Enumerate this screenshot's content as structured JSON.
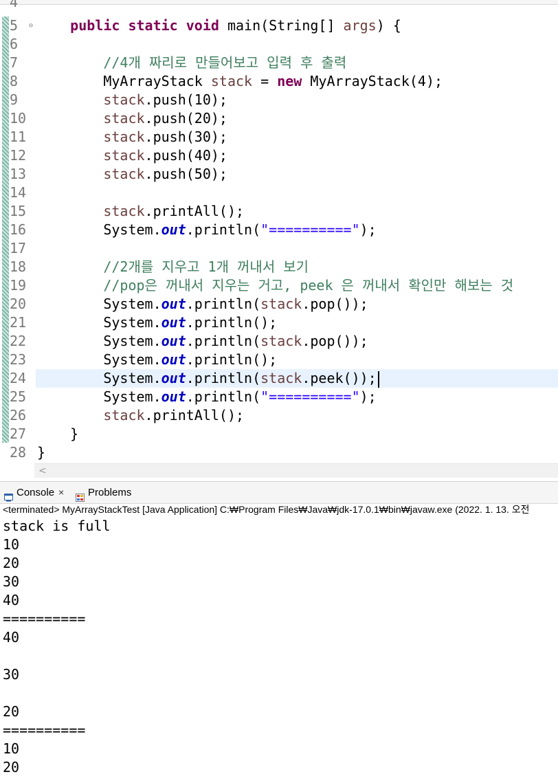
{
  "editor": {
    "top_partial_line_number": "4",
    "lines": [
      {
        "n": "5",
        "fold": "⊖",
        "tokens": [
          [
            "",
            "    "
          ],
          [
            "kw",
            "public static void "
          ],
          [
            "",
            "main(String[] "
          ],
          [
            "var",
            "args"
          ],
          [
            "",
            ") {"
          ]
        ]
      },
      {
        "n": "6",
        "tokens": []
      },
      {
        "n": "7",
        "tokens": [
          [
            "",
            "        "
          ],
          [
            "cm",
            "//4개 짜리로 만들어보고 입력 후 출력"
          ]
        ]
      },
      {
        "n": "8",
        "tokens": [
          [
            "",
            "        MyArrayStack "
          ],
          [
            "var",
            "stack"
          ],
          [
            "",
            " = "
          ],
          [
            "kw",
            "new"
          ],
          [
            "",
            " MyArrayStack(4);"
          ]
        ]
      },
      {
        "n": "9",
        "tokens": [
          [
            "",
            "        "
          ],
          [
            "var",
            "stack"
          ],
          [
            "",
            ".push(10);"
          ]
        ]
      },
      {
        "n": "10",
        "tokens": [
          [
            "",
            "        "
          ],
          [
            "var",
            "stack"
          ],
          [
            "",
            ".push(20);"
          ]
        ]
      },
      {
        "n": "11",
        "tokens": [
          [
            "",
            "        "
          ],
          [
            "var",
            "stack"
          ],
          [
            "",
            ".push(30);"
          ]
        ]
      },
      {
        "n": "12",
        "tokens": [
          [
            "",
            "        "
          ],
          [
            "var",
            "stack"
          ],
          [
            "",
            ".push(40);"
          ]
        ]
      },
      {
        "n": "13",
        "tokens": [
          [
            "",
            "        "
          ],
          [
            "var",
            "stack"
          ],
          [
            "",
            ".push(50);"
          ]
        ]
      },
      {
        "n": "14",
        "tokens": []
      },
      {
        "n": "15",
        "tokens": [
          [
            "",
            "        "
          ],
          [
            "var",
            "stack"
          ],
          [
            "",
            ".printAll();"
          ]
        ]
      },
      {
        "n": "16",
        "tokens": [
          [
            "",
            "        System."
          ],
          [
            "fld",
            "out"
          ],
          [
            "",
            ".println("
          ],
          [
            "str",
            "\"==========\""
          ],
          [
            "",
            ");"
          ]
        ]
      },
      {
        "n": "17",
        "tokens": []
      },
      {
        "n": "18",
        "tokens": [
          [
            "",
            "        "
          ],
          [
            "cm",
            "//2개를 지우고 1개 꺼내서 보기"
          ]
        ]
      },
      {
        "n": "19",
        "tokens": [
          [
            "",
            "        "
          ],
          [
            "cm",
            "//pop은 꺼내서 지우는 거고, peek 은 꺼내서 확인만 해보는 것"
          ]
        ]
      },
      {
        "n": "20",
        "tokens": [
          [
            "",
            "        System."
          ],
          [
            "fld",
            "out"
          ],
          [
            "",
            ".println("
          ],
          [
            "var",
            "stack"
          ],
          [
            "",
            ".pop());"
          ]
        ]
      },
      {
        "n": "21",
        "tokens": [
          [
            "",
            "        System."
          ],
          [
            "fld",
            "out"
          ],
          [
            "",
            ".println();"
          ]
        ]
      },
      {
        "n": "22",
        "tokens": [
          [
            "",
            "        System."
          ],
          [
            "fld",
            "out"
          ],
          [
            "",
            ".println("
          ],
          [
            "var",
            "stack"
          ],
          [
            "",
            ".pop());"
          ]
        ]
      },
      {
        "n": "23",
        "tokens": [
          [
            "",
            "        System."
          ],
          [
            "fld",
            "out"
          ],
          [
            "",
            ".println();"
          ]
        ]
      },
      {
        "n": "24",
        "current": true,
        "tokens": [
          [
            "",
            "        System."
          ],
          [
            "fld",
            "out"
          ],
          [
            "",
            ".println("
          ],
          [
            "var",
            "stack"
          ],
          [
            "",
            ".peek());"
          ]
        ]
      },
      {
        "n": "25",
        "tokens": [
          [
            "",
            "        System."
          ],
          [
            "fld",
            "out"
          ],
          [
            "",
            ".println("
          ],
          [
            "str",
            "\"==========\""
          ],
          [
            "",
            ");"
          ]
        ]
      },
      {
        "n": "26",
        "tokens": [
          [
            "",
            "        "
          ],
          [
            "var",
            "stack"
          ],
          [
            "",
            ".printAll();"
          ]
        ]
      },
      {
        "n": "27",
        "tokens": [
          [
            "",
            "    }"
          ]
        ]
      },
      {
        "n": "28",
        "tokens": [
          [
            "",
            "}"
          ]
        ]
      }
    ],
    "hscroll_left_arrow": "<"
  },
  "console": {
    "tabs": [
      {
        "label": "Console",
        "icon": "console-icon",
        "active": true,
        "close": "×"
      },
      {
        "label": "Problems",
        "icon": "problems-icon",
        "active": false
      }
    ],
    "status": "<terminated> MyArrayStackTest [Java Application] C:₩Program Files₩Java₩jdk-17.0.1₩bin₩javaw.exe  (2022. 1. 13. 오전",
    "output": [
      "stack is full",
      "10",
      "20",
      "30",
      "40",
      "==========",
      "40",
      "",
      "30",
      "",
      "20",
      "==========",
      "10",
      "20"
    ]
  },
  "colors": {
    "keyword": "#7f0055",
    "comment": "#3f7f5f",
    "string": "#2a00ff",
    "static_field": "#0000c0",
    "local_variable": "#6a3e3e",
    "current_line_highlight": "#e8f2fe"
  }
}
